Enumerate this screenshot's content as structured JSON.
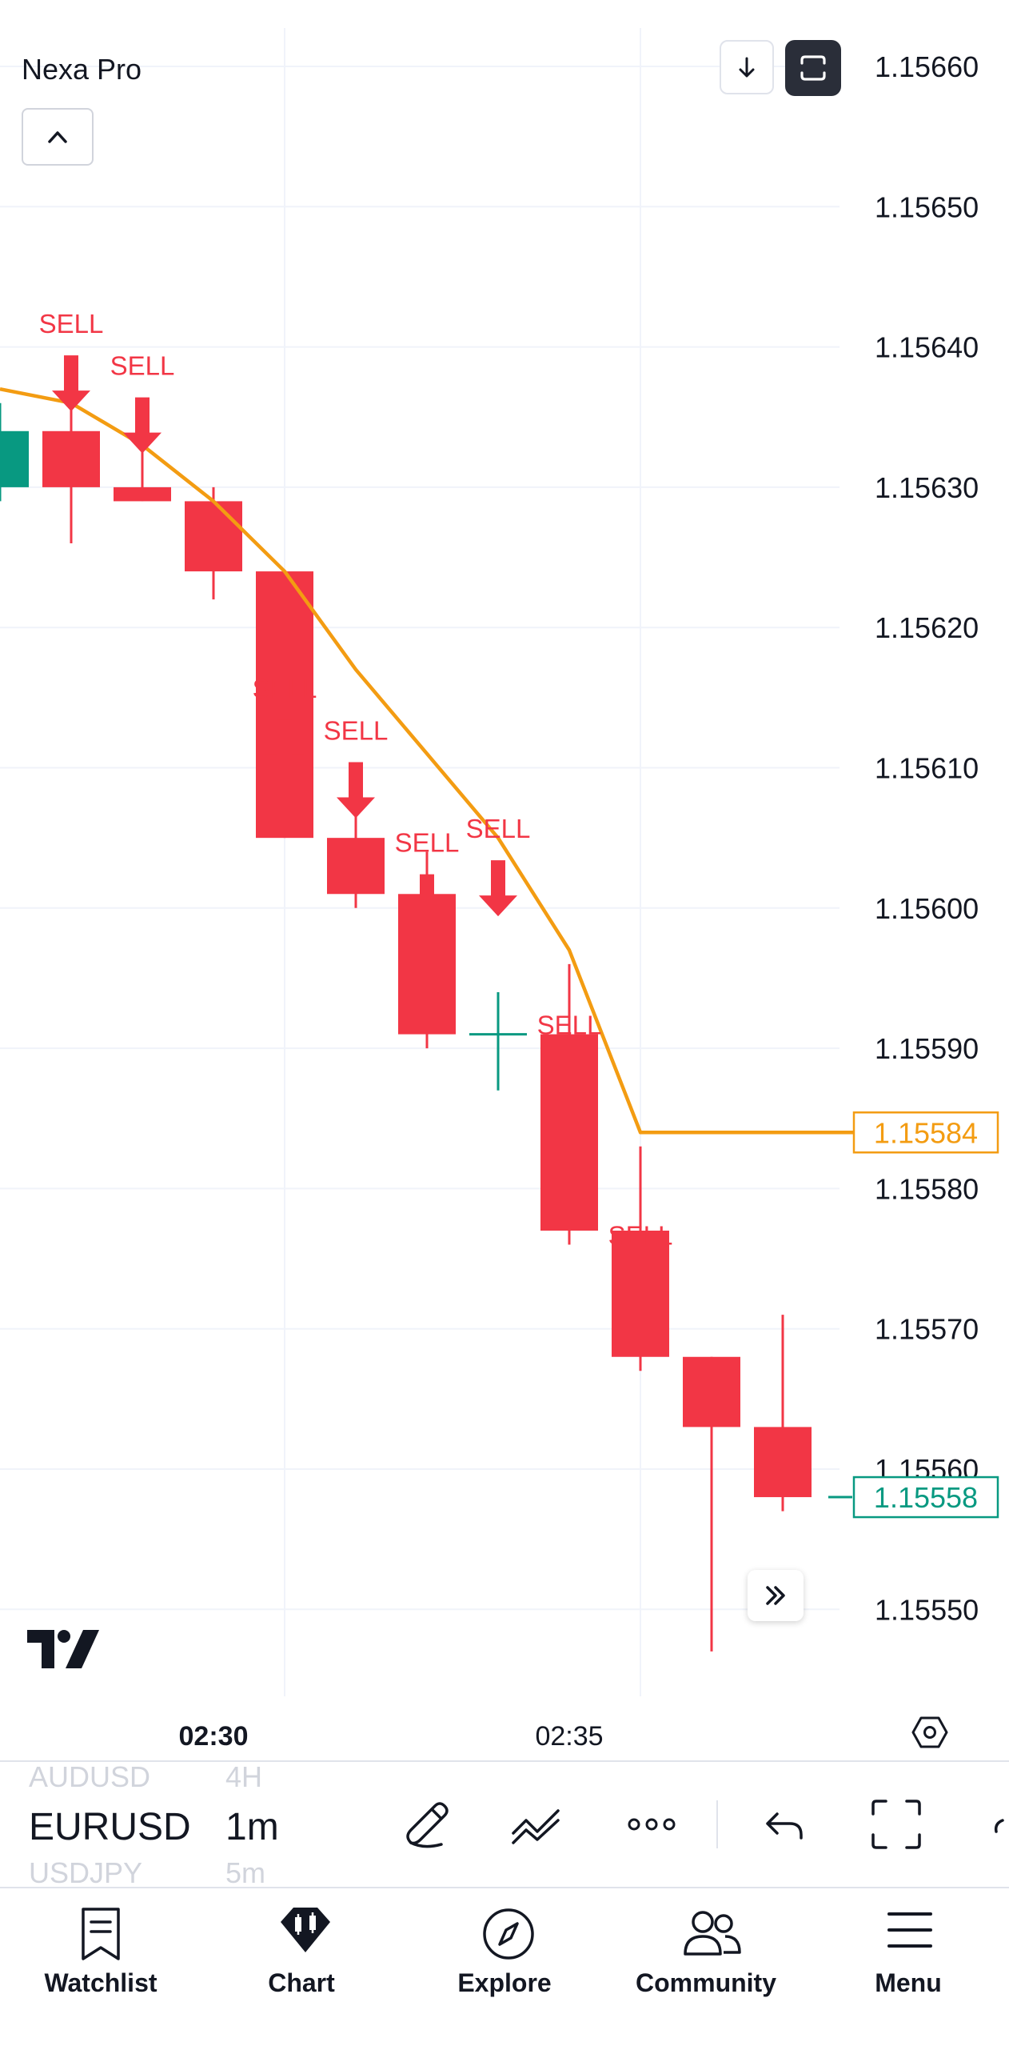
{
  "header": {
    "indicator_name": "Nexa Pro"
  },
  "colors": {
    "bear": "#f23645",
    "bull": "#089981",
    "ma_line": "#f39c12",
    "grid": "#f0f3fa",
    "text": "#131722",
    "signal": "#f23645"
  },
  "chart_data": {
    "type": "candlestick",
    "symbol": "EURUSD",
    "interval": "1m",
    "ylim": [
      1.15545,
      1.15662
    ],
    "y_ticks": [
      "1.15660",
      "1.15650",
      "1.15640",
      "1.15630",
      "1.15620",
      "1.15610",
      "1.15600",
      "1.15590",
      "1.15580",
      "1.15570",
      "1.15560",
      "1.15550"
    ],
    "y_tick_values": [
      1.1566,
      1.1565,
      1.1564,
      1.1563,
      1.1562,
      1.1561,
      1.156,
      1.1559,
      1.1558,
      1.1557,
      1.1556,
      1.1555
    ],
    "x_ticks": [
      {
        "label": "02:30",
        "index": 3,
        "bold": true
      },
      {
        "label": "02:35",
        "index": 8,
        "bold": false
      }
    ],
    "candles": [
      {
        "i": 0,
        "o": 1.1563,
        "h": 1.15636,
        "l": 1.15629,
        "c": 1.15634
      },
      {
        "i": 1,
        "o": 1.15634,
        "h": 1.15638,
        "l": 1.15626,
        "c": 1.1563
      },
      {
        "i": 2,
        "o": 1.1563,
        "h": 1.15633,
        "l": 1.15629,
        "c": 1.15629
      },
      {
        "i": 3,
        "o": 1.15629,
        "h": 1.1563,
        "l": 1.15622,
        "c": 1.15624
      },
      {
        "i": 4,
        "o": 1.15624,
        "h": 1.15624,
        "l": 1.15605,
        "c": 1.15605
      },
      {
        "i": 5,
        "o": 1.15605,
        "h": 1.15607,
        "l": 1.156,
        "c": 1.15601
      },
      {
        "i": 6,
        "o": 1.15601,
        "h": 1.15604,
        "l": 1.1559,
        "c": 1.15591
      },
      {
        "i": 7,
        "o": 1.15591,
        "h": 1.15594,
        "l": 1.15587,
        "c": 1.15591
      },
      {
        "i": 8,
        "o": 1.15591,
        "h": 1.15596,
        "l": 1.15576,
        "c": 1.15577
      },
      {
        "i": 9,
        "o": 1.15577,
        "h": 1.15583,
        "l": 1.15567,
        "c": 1.15568
      },
      {
        "i": 10,
        "o": 1.15568,
        "h": 1.15568,
        "l": 1.15547,
        "c": 1.15563
      },
      {
        "i": 11,
        "o": 1.15563,
        "h": 1.15571,
        "l": 1.15557,
        "c": 1.15558
      }
    ],
    "ma_series": [
      {
        "i": -1,
        "v": 1.15637
      },
      {
        "i": 1,
        "v": 1.15636
      },
      {
        "i": 2,
        "v": 1.15633
      },
      {
        "i": 3,
        "v": 1.15629
      },
      {
        "i": 4,
        "v": 1.15624
      },
      {
        "i": 5,
        "v": 1.15617
      },
      {
        "i": 6,
        "v": 1.15611
      },
      {
        "i": 7,
        "v": 1.15605
      },
      {
        "i": 8,
        "v": 1.15597
      },
      {
        "i": 9,
        "v": 1.15584
      }
    ],
    "signals": [
      {
        "i": 1.0,
        "label": "SELL",
        "price": 1.15641
      },
      {
        "i": 2.0,
        "label": "SELL",
        "price": 1.15638
      },
      {
        "i": 4.0,
        "label": "SELL",
        "price": 1.15615
      },
      {
        "i": 5.0,
        "label": "SELL",
        "price": 1.15612
      },
      {
        "i": 6.0,
        "label": "SELL",
        "price": 1.15604
      },
      {
        "i": 7.0,
        "label": "SELL",
        "price": 1.15605
      },
      {
        "i": 8.0,
        "label": "SELL",
        "price": 1.15591
      },
      {
        "i": 9.0,
        "label": "SELL",
        "price": 1.15576
      }
    ],
    "price_labels": [
      {
        "value": "1.15584",
        "price": 1.15584,
        "role": "ma"
      },
      {
        "value": "1.15558",
        "price": 1.15558,
        "role": "last"
      }
    ]
  },
  "toolbar": {
    "symbols": [
      "AUDUSD",
      "EURUSD",
      "USDJPY"
    ],
    "intervals": [
      "4H",
      "1m",
      "5m"
    ]
  },
  "nav": {
    "items": [
      "Watchlist",
      "Chart",
      "Explore",
      "Community",
      "Menu"
    ]
  }
}
